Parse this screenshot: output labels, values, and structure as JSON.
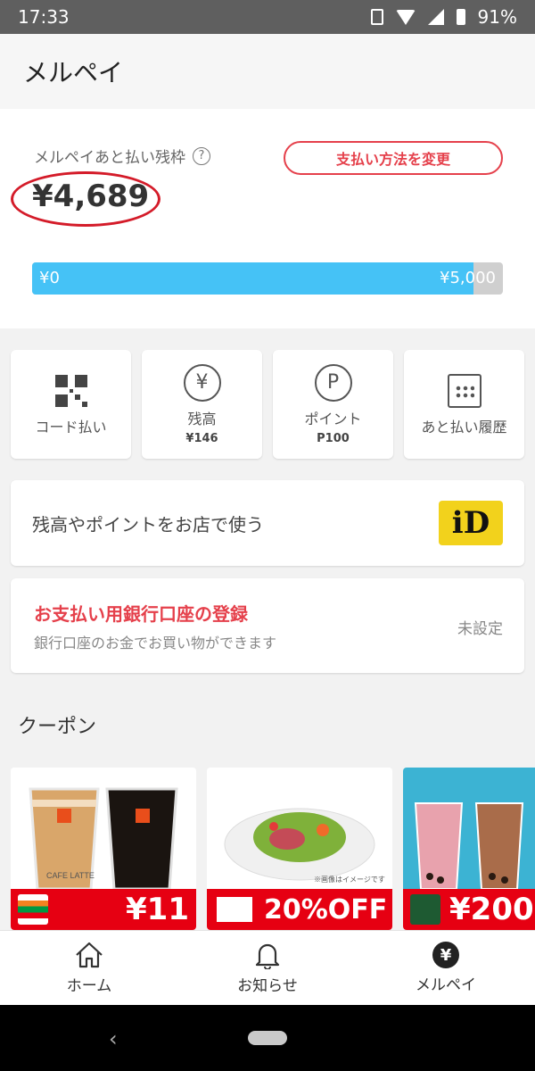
{
  "status_bar": {
    "time": "17:33",
    "battery": "91%"
  },
  "header": {
    "title": "メルペイ"
  },
  "balance": {
    "label": "メルペイあと払い残枠",
    "help_symbol": "?",
    "amount": "¥4,689",
    "change_button": "支払い方法を変更",
    "bar_min": "¥0",
    "bar_max": "¥5,000",
    "bar_fill_fraction": 0.9378
  },
  "tiles": [
    {
      "label": "コード払い",
      "sub": "",
      "icon": "qr-code-icon"
    },
    {
      "label": "残高",
      "sub": "¥146",
      "icon": "yen-circle-icon",
      "symbol": "¥"
    },
    {
      "label": "ポイント",
      "sub": "P100",
      "icon": "point-circle-icon",
      "symbol": "P"
    },
    {
      "label": "あと払い履歴",
      "sub": "",
      "icon": "calendar-icon"
    }
  ],
  "id_card": {
    "label": "残高やポイントをお店で使う",
    "logo_text": "iD"
  },
  "bank": {
    "title": "お支払い用銀行口座の登録",
    "subtitle": "銀行口座のお金でお買い物ができます",
    "status": "未設定"
  },
  "coupons": {
    "title": "クーポン",
    "items": [
      {
        "offer": "¥11",
        "image_caption": "CAFE LATTE"
      },
      {
        "offer": "20%OFF",
        "image_caption": "※画像はイメージです"
      },
      {
        "offer": "¥200",
        "image_caption": ""
      }
    ]
  },
  "bottom_nav": [
    {
      "label": "ホーム",
      "icon": "home-icon"
    },
    {
      "label": "お知らせ",
      "icon": "bell-icon"
    },
    {
      "label": "メルペイ",
      "icon": "yen-icon",
      "symbol": "¥"
    }
  ],
  "colors": {
    "accent": "#e5404b",
    "bar": "#45c2f6",
    "coupon_red": "#e60012"
  }
}
